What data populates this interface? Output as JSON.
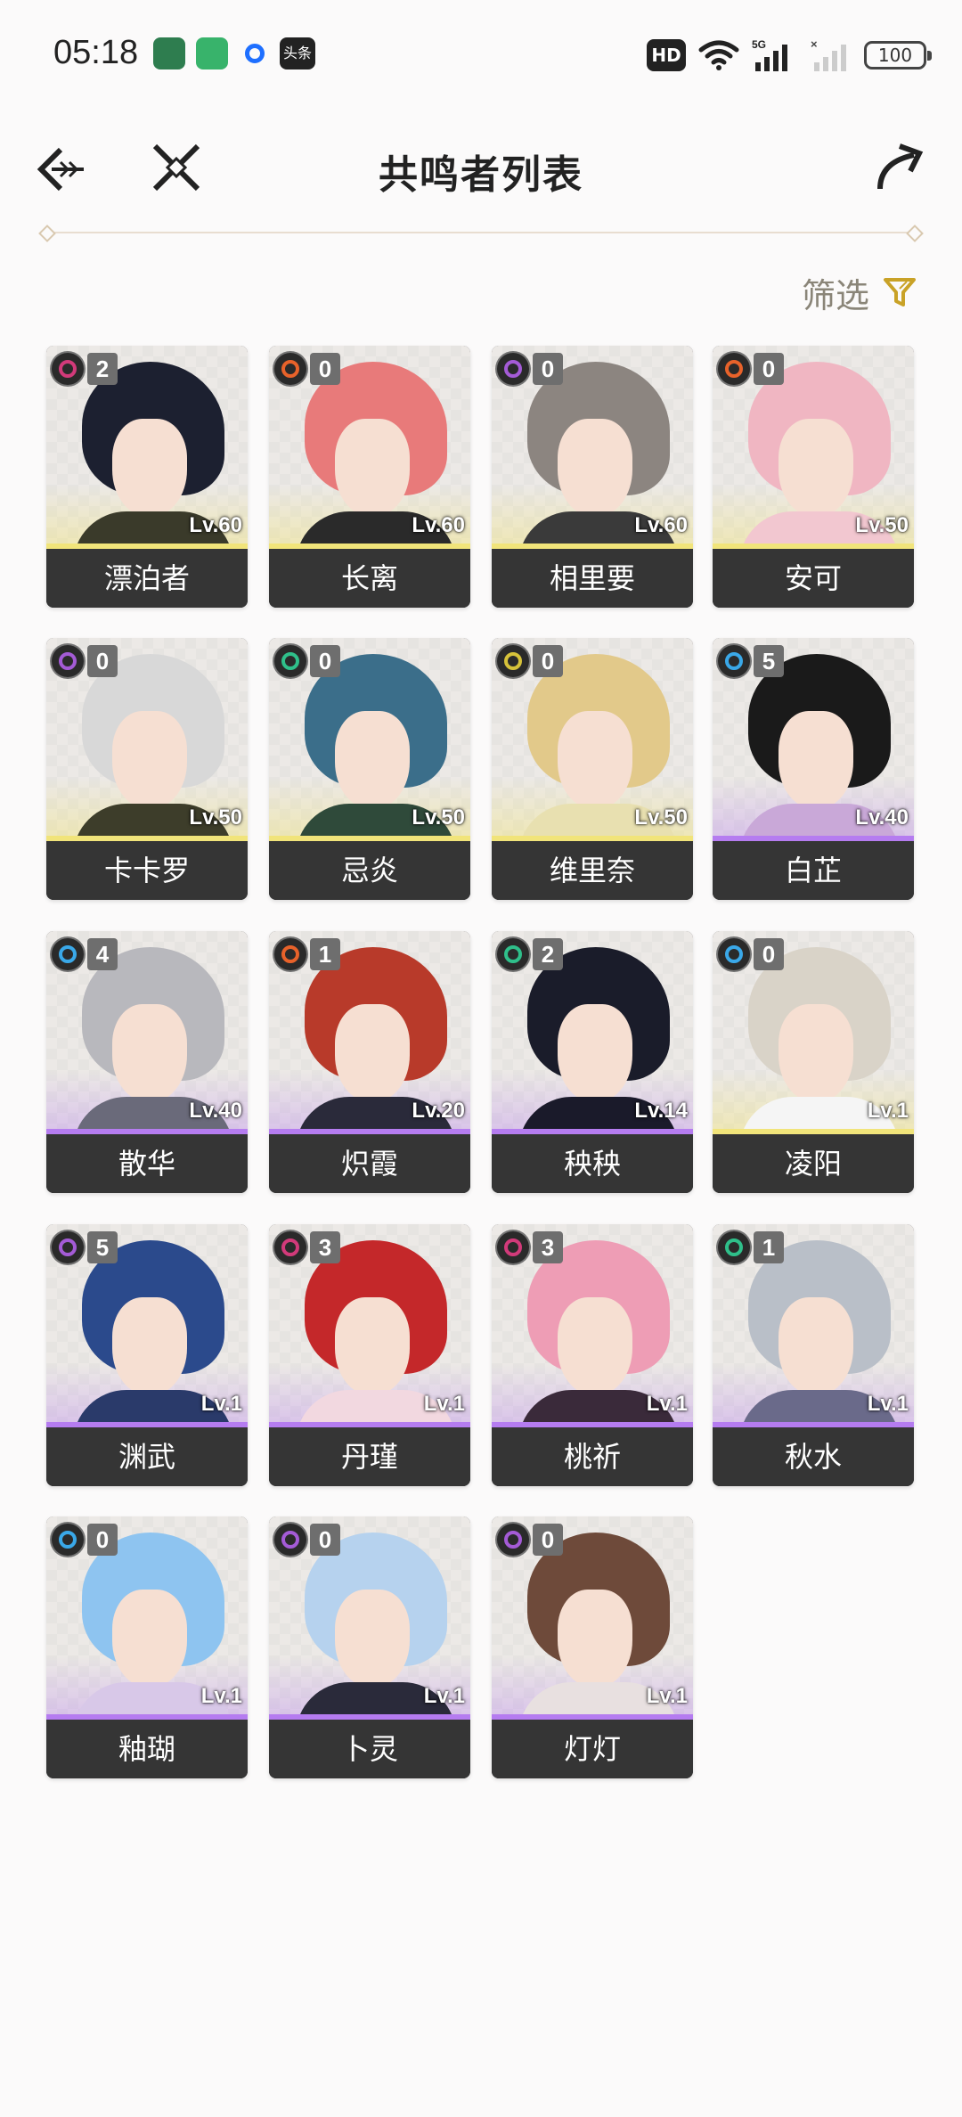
{
  "status_bar": {
    "time": "05:18",
    "apps": [
      "app-green-icon",
      "shield-app-icon",
      "blue-circle-app-icon",
      "toutiao-app-icon"
    ],
    "toutiao_label": "头条",
    "hd_label": "HD",
    "battery": "100"
  },
  "header": {
    "title": "共鸣者列表"
  },
  "filter": {
    "label": "筛选",
    "accent_color": "#c9a227"
  },
  "colors": {
    "five_star": "#f1e47a",
    "four_star": "#b57cf0",
    "name_bar": "#353535"
  },
  "characters": [
    {
      "name": "漂泊者",
      "level": "Lv.60",
      "sequence": "2",
      "element": "havoc",
      "rarity": 5
    },
    {
      "name": "长离",
      "level": "Lv.60",
      "sequence": "0",
      "element": "fusion",
      "rarity": 5
    },
    {
      "name": "相里要",
      "level": "Lv.60",
      "sequence": "0",
      "element": "electro",
      "rarity": 5
    },
    {
      "name": "安可",
      "level": "Lv.50",
      "sequence": "0",
      "element": "fusion",
      "rarity": 5
    },
    {
      "name": "卡卡罗",
      "level": "Lv.50",
      "sequence": "0",
      "element": "electro",
      "rarity": 5
    },
    {
      "name": "忌炎",
      "level": "Lv.50",
      "sequence": "0",
      "element": "aero",
      "rarity": 5
    },
    {
      "name": "维里奈",
      "level": "Lv.50",
      "sequence": "0",
      "element": "spectro",
      "rarity": 5
    },
    {
      "name": "白芷",
      "level": "Lv.40",
      "sequence": "5",
      "element": "glacio",
      "rarity": 4
    },
    {
      "name": "散华",
      "level": "Lv.40",
      "sequence": "4",
      "element": "glacio",
      "rarity": 4
    },
    {
      "name": "炽霞",
      "level": "Lv.20",
      "sequence": "1",
      "element": "fusion",
      "rarity": 4
    },
    {
      "name": "秧秧",
      "level": "Lv.14",
      "sequence": "2",
      "element": "aero",
      "rarity": 4
    },
    {
      "name": "凌阳",
      "level": "Lv.1",
      "sequence": "0",
      "element": "glacio",
      "rarity": 5
    },
    {
      "name": "渊武",
      "level": "Lv.1",
      "sequence": "5",
      "element": "electro",
      "rarity": 4
    },
    {
      "name": "丹瑾",
      "level": "Lv.1",
      "sequence": "3",
      "element": "havoc",
      "rarity": 4
    },
    {
      "name": "桃祈",
      "level": "Lv.1",
      "sequence": "3",
      "element": "havoc",
      "rarity": 4
    },
    {
      "name": "秋水",
      "level": "Lv.1",
      "sequence": "1",
      "element": "aero",
      "rarity": 4
    },
    {
      "name": "釉瑚",
      "level": "Lv.1",
      "sequence": "0",
      "element": "glacio",
      "rarity": 4
    },
    {
      "name": "卜灵",
      "level": "Lv.1",
      "sequence": "0",
      "element": "electro",
      "rarity": 4
    },
    {
      "name": "灯灯",
      "level": "Lv.1",
      "sequence": "0",
      "element": "electro",
      "rarity": 4
    }
  ],
  "element_colors": {
    "havoc": "#d23a7a",
    "fusion": "#e8622a",
    "electro": "#a45bd6",
    "aero": "#2fbf8a",
    "spectro": "#d6c23a",
    "glacio": "#3aa8e8"
  }
}
